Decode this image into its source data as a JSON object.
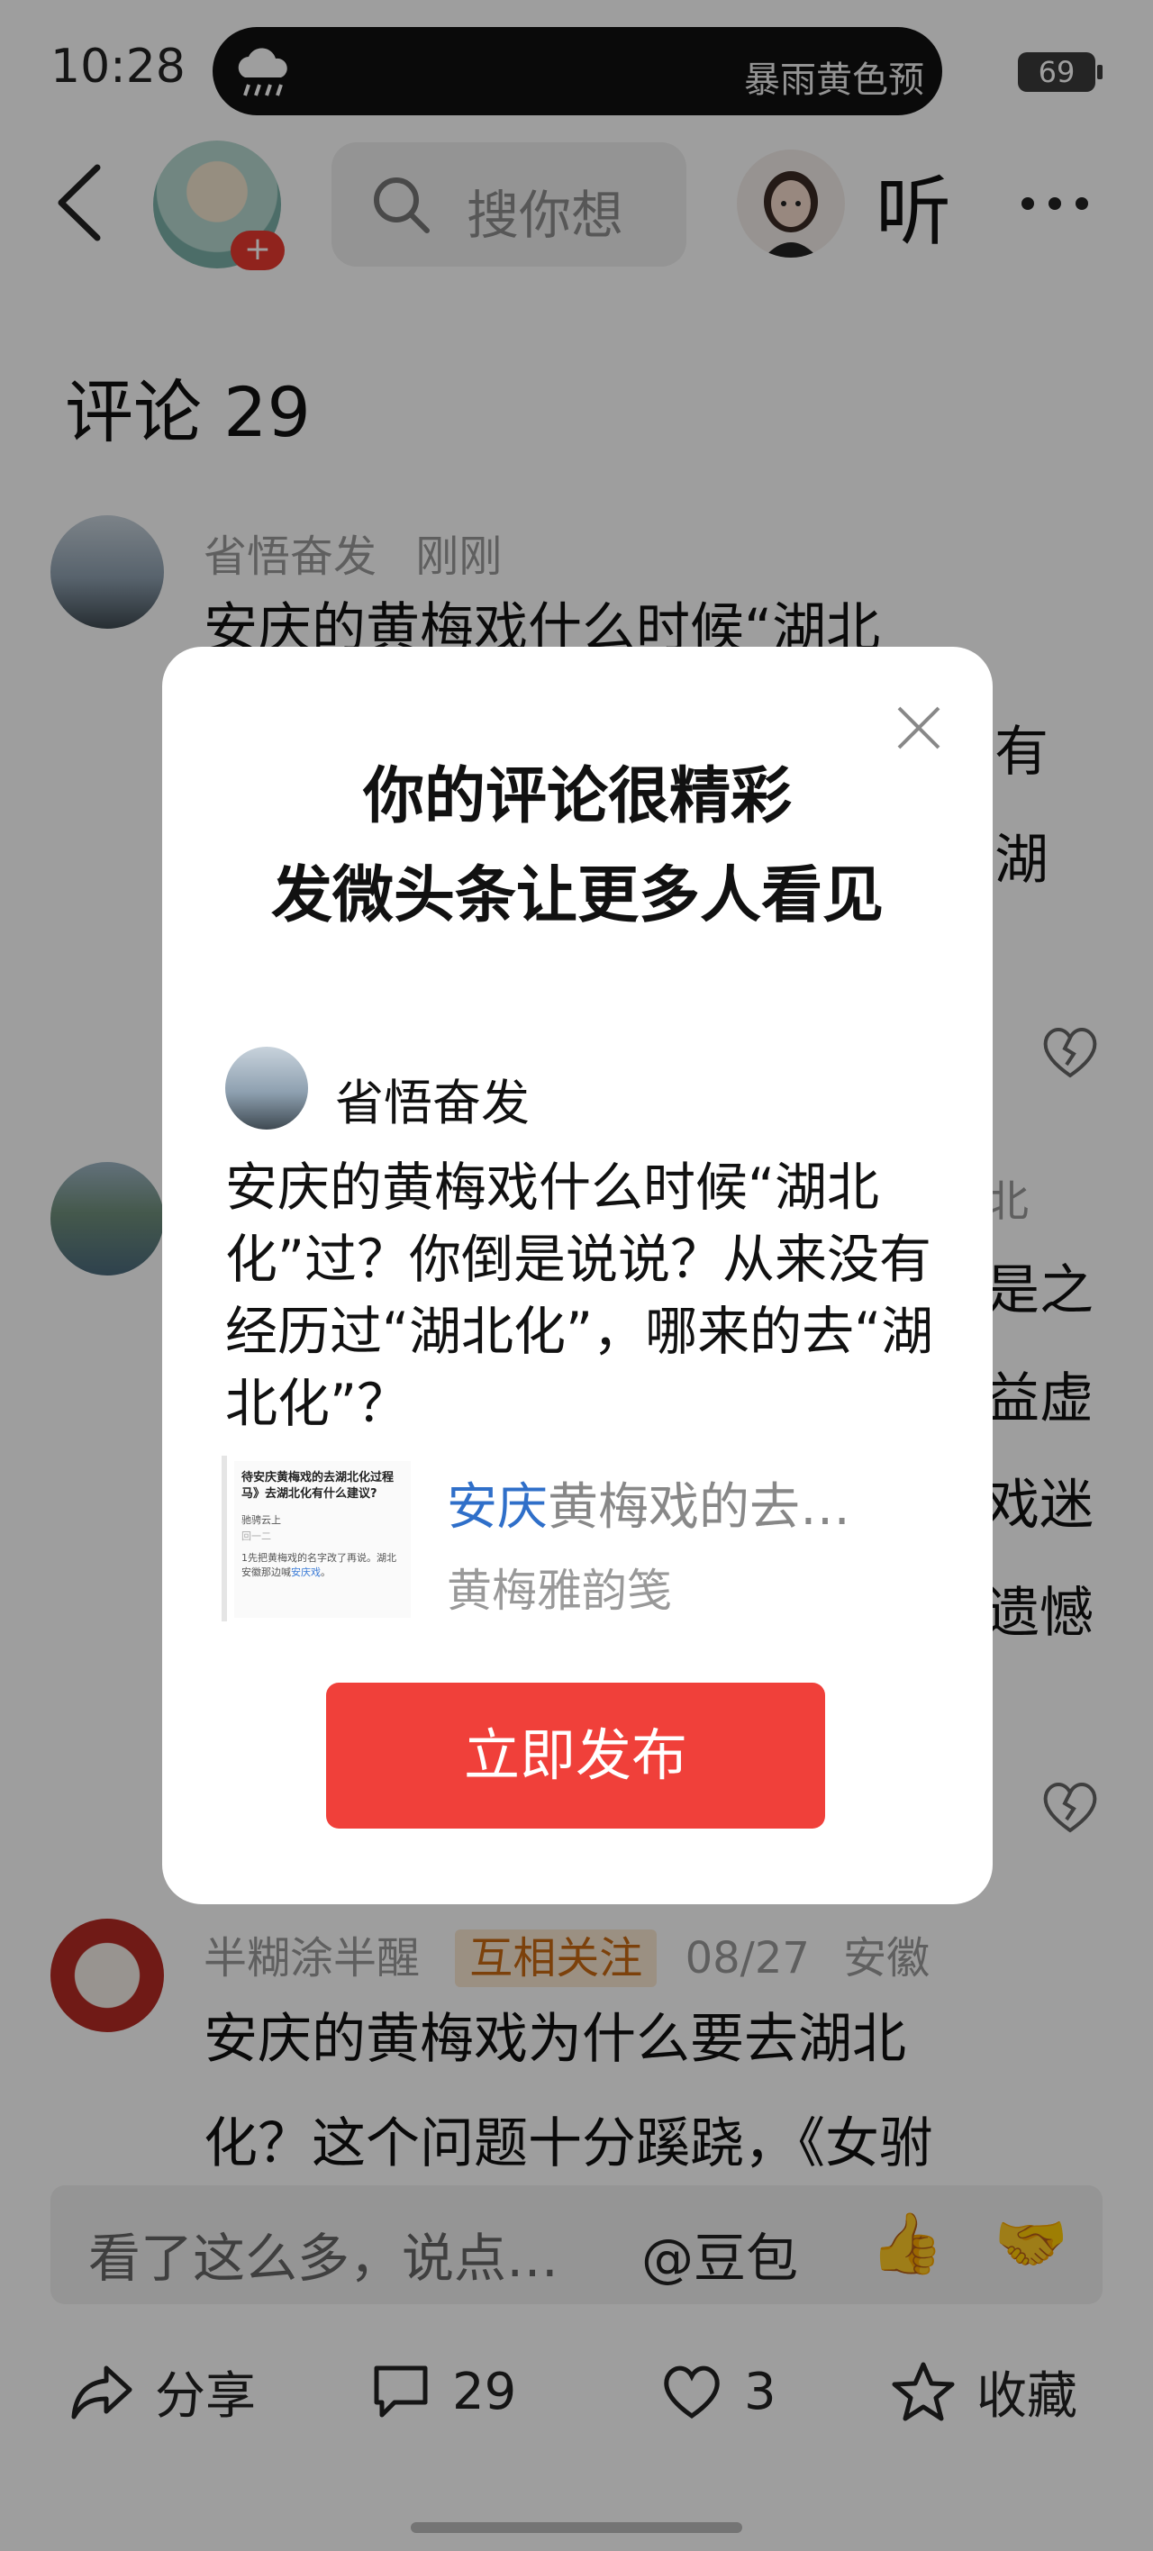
{
  "status_bar": {
    "time": "10:28",
    "weather_alert": "暴雨黄色预",
    "battery": "69"
  },
  "top_bar": {
    "search_placeholder": "搜你想",
    "listen_label": "听"
  },
  "comments": {
    "title": "评论 29",
    "items": [
      {
        "user": "省悟奋发",
        "time": "刚刚",
        "text": "安庆的黄梅戏什么时候“湖北",
        "partial_right": [
          "有",
          "湖"
        ]
      },
      {
        "partial_right": [
          "北",
          "是之",
          "益虚",
          "戏迷",
          "遗憾"
        ]
      },
      {
        "user": "半糊涂半醒",
        "tag": "互相关注",
        "time": "08/27",
        "location": "安徽",
        "text_lines": [
          "安庆的黄梅戏为什么要去湖北",
          "化？这个问题十分蹊跷，《女驸"
        ]
      }
    ]
  },
  "comment_input": {
    "placeholder": "看了这么多，说点…",
    "mention": "@豆包",
    "emoji_1": "👍",
    "emoji_2": "🤝"
  },
  "actions": {
    "share": "分享",
    "comments_count": "29",
    "likes": "3",
    "favorite": "收藏"
  },
  "modal": {
    "line1": "你的评论很精彩",
    "line2": "发微头条让更多人看见",
    "author": "省悟奋发",
    "comment": "安庆的黄梅戏什么时候“湖北化”过？你倒是说说？从来没有经历过“湖北化”，哪来的去“湖北化”？",
    "card": {
      "title_highlight": "安庆",
      "title_rest": "黄梅戏的去…",
      "source": "黄梅雅韵笺",
      "thumb_title": "待安庆黄梅戏的去湖北化过程马》去湖北化有什么建议?",
      "thumb_line1": "驰骋云上",
      "thumb_line2": "回一二",
      "thumb_line3": "1先把黄梅戏的名字改了再说。湖北",
      "thumb_line4_pre": "安徽那边喊",
      "thumb_line4_hl": "安庆戏",
      "thumb_line4_post": "。"
    },
    "publish_button": "立即发布"
  },
  "colors": {
    "accent_red": "#f0403a",
    "link_blue": "#2f6fc9",
    "overlay": "rgba(0,0,0,0.38)"
  },
  "icons": [
    "back-icon",
    "search-icon",
    "more-icon",
    "close-icon",
    "broken-heart-icon",
    "share-icon",
    "comment-icon",
    "heart-icon",
    "star-icon",
    "cloud-rain-icon"
  ]
}
